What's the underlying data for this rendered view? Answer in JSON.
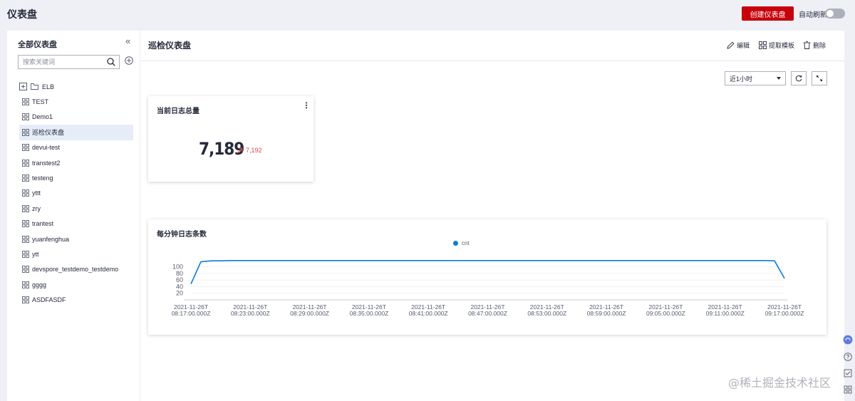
{
  "topbar": {
    "title": "仪表盘",
    "create_label": "创建仪表盘",
    "auto_refresh_label": "自动刷新"
  },
  "sidebar": {
    "title": "全部仪表盘",
    "search_placeholder": "搜索关键词",
    "folder": "ELB",
    "items": [
      "TEST",
      "Demo1",
      "巡检仪表盘",
      "devui-test",
      "transtest2",
      "testeng",
      "yttt",
      "zry",
      "trantest",
      "yuanfenghua",
      "ytt",
      "devspore_testdemo_testdemo",
      "gggg",
      "ASDFASDF"
    ],
    "active_index": 2
  },
  "main": {
    "title": "巡检仪表盘",
    "actions": {
      "edit": "编辑",
      "template": "提取模板",
      "delete": "删除"
    },
    "time_range": "近1小时"
  },
  "kpi": {
    "title": "当前日志总量",
    "value": "7,189",
    "compare": "7,192",
    "trend_color": "#e54545"
  },
  "line_card": {
    "title": "每分钟日志条数"
  },
  "chart_data": {
    "type": "line",
    "legend_position": "top",
    "series": [
      {
        "name": "cnt",
        "color": "#0d7bd8",
        "values": [
          48,
          115,
          118,
          118,
          119,
          119,
          119,
          119,
          119,
          119,
          119,
          119,
          119,
          119,
          119,
          119,
          119,
          119,
          119,
          119,
          119,
          119,
          119,
          119,
          119,
          119,
          119,
          119,
          119,
          119,
          119,
          119,
          119,
          119,
          119,
          119,
          119,
          119,
          119,
          119,
          119,
          119,
          119,
          119,
          119,
          119,
          119,
          119,
          119,
          119,
          119,
          119,
          119,
          119,
          119,
          119,
          119,
          119,
          119,
          118,
          65
        ]
      }
    ],
    "x_start": "2021-11-26T08:17:00.000Z",
    "x_step_minutes": 1,
    "x_ticks": [
      [
        "2021-11-26T",
        "08:17:00.000Z"
      ],
      [
        "2021-11-26T",
        "08:23:00.000Z"
      ],
      [
        "2021-11-26T",
        "08:29:00.000Z"
      ],
      [
        "2021-11-26T",
        "08:35:00.000Z"
      ],
      [
        "2021-11-26T",
        "08:41:00.000Z"
      ],
      [
        "2021-11-26T",
        "08:47:00.000Z"
      ],
      [
        "2021-11-26T",
        "08:53:00.000Z"
      ],
      [
        "2021-11-26T",
        "08:59:00.000Z"
      ],
      [
        "2021-11-26T",
        "09:05:00.000Z"
      ],
      [
        "2021-11-26T",
        "09:11:00.000Z"
      ],
      [
        "2021-11-26T",
        "09:17:00.000Z"
      ]
    ],
    "y_ticks": [
      20,
      40,
      60,
      80,
      100
    ],
    "ylim": [
      0,
      125
    ],
    "grid": true
  },
  "watermark": "@稀土掘金技术社区"
}
